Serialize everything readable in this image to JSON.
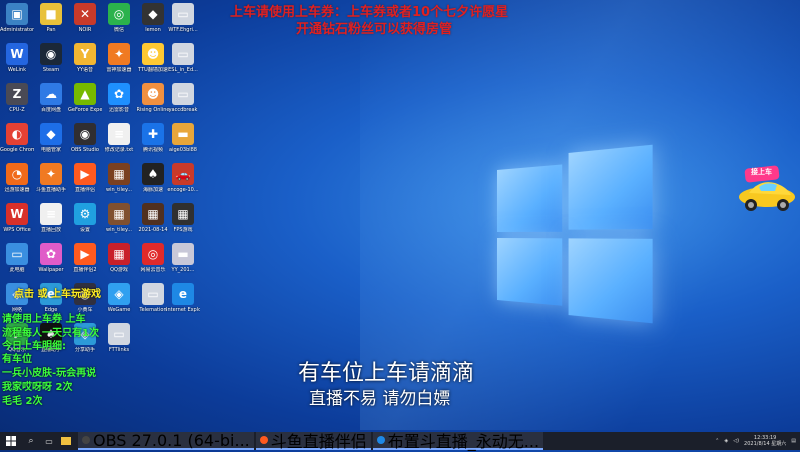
{
  "overlay_top": {
    "line1": "上车请使用上车券：上车券或者10个七夕许愿星",
    "line2": "开通钻石粉丝可以获得房管"
  },
  "center": {
    "line1": "有车位上车请滴滴",
    "line2": "直播不易 请勿白嫖"
  },
  "car_badge": "接上车",
  "chat": [
    {
      "text": "点击    或    上车玩游戏",
      "color": "yellow"
    },
    {
      "text": "请使用上车券   上车",
      "color": "green"
    },
    {
      "text": "流程每人一天只有1次",
      "color": "green"
    },
    {
      "text": "今日上车明细:",
      "color": "green"
    },
    {
      "text": "有车位",
      "color": "green"
    },
    {
      "text": "一兵小皮肤-玩会再说",
      "color": "green"
    },
    {
      "text": "我家哎呀呀    2次",
      "color": "green"
    },
    {
      "text": "毛毛        2次",
      "color": "green"
    }
  ],
  "icons": [
    {
      "label": "Administrator",
      "color": "#3b82c4",
      "glyph": "▣"
    },
    {
      "label": "Pan",
      "color": "#e8c13a",
      "glyph": "■"
    },
    {
      "label": "NOIR",
      "color": "#c83a2a",
      "glyph": "✕"
    },
    {
      "label": "微信",
      "color": "#2bb24c",
      "glyph": "◎"
    },
    {
      "label": "lemon",
      "color": "#333",
      "glyph": "◆"
    },
    {
      "label": "WTF.Ehgri...",
      "color": "#d0d6e0",
      "glyph": "▭"
    },
    {
      "label": "WeLink",
      "color": "#2466e0",
      "glyph": "W"
    },
    {
      "label": "Steam",
      "color": "#1b2838",
      "glyph": "◉"
    },
    {
      "label": "YY语音",
      "color": "#f2b632",
      "glyph": "Y"
    },
    {
      "label": "雷神加速器",
      "color": "#f07a22",
      "glyph": "✦"
    },
    {
      "label": "TTU翻墙加速",
      "color": "#ffc933",
      "glyph": "☻"
    },
    {
      "label": "ESL_in_Ed...",
      "color": "#d0d6e0",
      "glyph": "▭"
    },
    {
      "label": "CPU-Z",
      "color": "#4a4a55",
      "glyph": "Z"
    },
    {
      "label": "百度网盘",
      "color": "#2f7ae5",
      "glyph": "☁"
    },
    {
      "label": "GeForce Experience",
      "color": "#76b900",
      "glyph": "▲"
    },
    {
      "label": "迅雷影音",
      "color": "#1e90ff",
      "glyph": "✿"
    },
    {
      "label": "Rising Online",
      "color": "#f09040",
      "glyph": "☻"
    },
    {
      "label": "yaccdbreak",
      "color": "#d0d6e0",
      "glyph": "▭"
    },
    {
      "label": "Google Chrome",
      "color": "#e44134",
      "glyph": "◐"
    },
    {
      "label": "电脑管家",
      "color": "#1d6ee8",
      "glyph": "◆"
    },
    {
      "label": "OBS Studio",
      "color": "#302e31",
      "glyph": "◉"
    },
    {
      "label": "修改记录.txt",
      "color": "#f0f0f0",
      "glyph": "≡"
    },
    {
      "label": "腾讯视频",
      "color": "#1a73e8",
      "glyph": "✚"
    },
    {
      "label": "aige03bl88",
      "color": "#e8a63a",
      "glyph": "▬"
    },
    {
      "label": "迅游加速器",
      "color": "#f06a1a",
      "glyph": "◔"
    },
    {
      "label": "斗鱼直播助手",
      "color": "#f07a22",
      "glyph": "✦"
    },
    {
      "label": "直播伴侣",
      "color": "#ff5a1f",
      "glyph": "▶"
    },
    {
      "label": "win_tiley...",
      "color": "#7a4020",
      "glyph": "▦"
    },
    {
      "label": "海豚加速",
      "color": "#222",
      "glyph": "♠"
    },
    {
      "label": "encoge-10...",
      "color": "#c83a2a",
      "glyph": "🚗"
    },
    {
      "label": "WPS Office",
      "color": "#d8302a",
      "glyph": "W"
    },
    {
      "label": "直播回放",
      "color": "#f0f0f0",
      "glyph": "≡"
    },
    {
      "label": "设置",
      "color": "#20a0e0",
      "glyph": "⚙"
    },
    {
      "label": "win_tiley...",
      "color": "#805030",
      "glyph": "▦"
    },
    {
      "label": "2021-08-14",
      "color": "#503020",
      "glyph": "▦"
    },
    {
      "label": "FPS游戏",
      "color": "#303030",
      "glyph": "▦"
    },
    {
      "label": "此电脑",
      "color": "#3a8fe0",
      "glyph": "▭"
    },
    {
      "label": "Wallpaper",
      "color": "#e05cc8",
      "glyph": "✿"
    },
    {
      "label": "直播伴侣2",
      "color": "#ff5a1f",
      "glyph": "▶"
    },
    {
      "label": "QQ游戏",
      "color": "#c8202a",
      "glyph": "▦"
    },
    {
      "label": "网易云音乐",
      "color": "#e02a2a",
      "glyph": "◎"
    },
    {
      "label": "YY_201...",
      "color": "#c8c8d8",
      "glyph": "▬"
    },
    {
      "label": "网络",
      "color": "#3a8fe0",
      "glyph": "◈"
    },
    {
      "label": "Edge",
      "color": "#2c9ad8",
      "glyph": "e"
    },
    {
      "label": "小黄车",
      "color": "#303040",
      "glyph": "◉"
    },
    {
      "label": "WeGame",
      "color": "#30a0f0",
      "glyph": "◈"
    },
    {
      "label": "Telemation",
      "color": "#d0d6e0",
      "glyph": "▭"
    },
    {
      "label": "Internet Explorer",
      "color": "#1e88e5",
      "glyph": "e"
    },
    {
      "label": "QQ音乐",
      "color": "#2faa4a",
      "glyph": "♪"
    },
    {
      "label": "直播助手",
      "color": "#111",
      "glyph": "♠"
    },
    {
      "label": "分享助手",
      "color": "#2c9ad8",
      "glyph": "◈"
    },
    {
      "label": "FTTlinks",
      "color": "#d0d6e0",
      "glyph": "▭"
    }
  ],
  "taskbar": {
    "apps": [
      {
        "label": "OBS 27.0.1 (64-bi...",
        "color": "#444"
      },
      {
        "label": "斗鱼直播伴侣",
        "color": "#ff5a1f"
      },
      {
        "label": "布置斗直播_永动无...",
        "color": "#1e88e5"
      }
    ],
    "time": "12:33:19",
    "date": "2021/8/14 星期六"
  }
}
